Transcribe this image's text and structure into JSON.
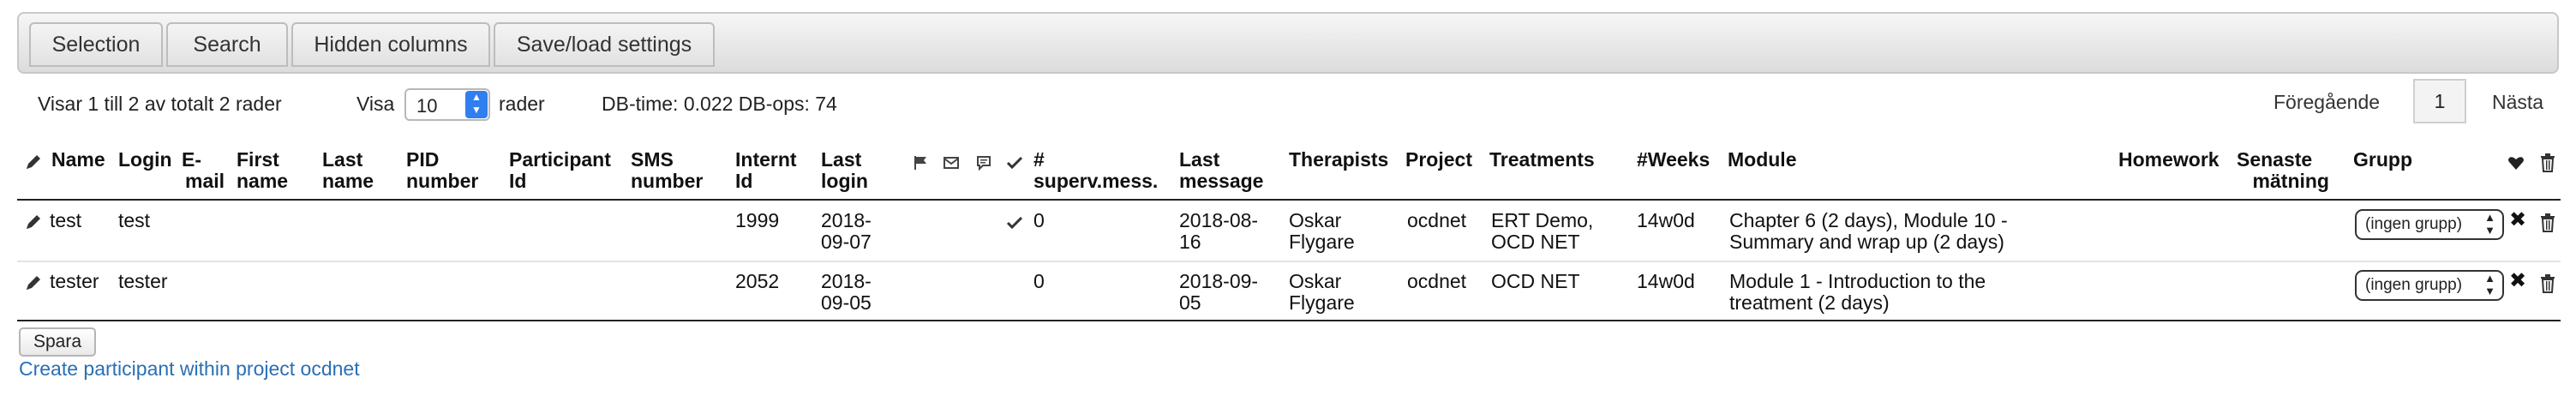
{
  "tabs": [
    {
      "label": "Selection"
    },
    {
      "label": "Search"
    },
    {
      "label": "Hidden columns"
    },
    {
      "label": "Save/load settings"
    }
  ],
  "info": {
    "showing": "Visar 1 till 2 av totalt 2 rader",
    "visa_label": "Visa",
    "visa_value": "10",
    "rader_label": "rader",
    "db_stats": "DB-time: 0.022 DB-ops: 74"
  },
  "pager": {
    "prev": "Föregående",
    "page": "1",
    "next": "Nästa"
  },
  "headers": {
    "name": "Name",
    "login": "Login",
    "email": [
      "E-",
      "mail"
    ],
    "first_name": [
      "First",
      "name"
    ],
    "last_name": [
      "Last",
      "name"
    ],
    "pid": [
      "PID",
      "number"
    ],
    "participant_id": [
      "Participant",
      "Id"
    ],
    "sms": [
      "SMS",
      "number"
    ],
    "intern_id": [
      "Internt",
      "Id"
    ],
    "last_login": [
      "Last",
      "login"
    ],
    "superv": [
      "#",
      "superv.mess."
    ],
    "last_message": [
      "Last",
      "message"
    ],
    "therapists": "Therapists",
    "project": "Project",
    "treatments": "Treatments",
    "weeks": "#Weeks",
    "module": "Module",
    "homework": "Homework",
    "senaste": [
      "Senaste",
      "mätning"
    ],
    "grupp": "Grupp"
  },
  "rows": [
    {
      "name": "test",
      "login": "test",
      "intern_id": "1999",
      "last_login": [
        "2018-",
        "09-07"
      ],
      "checked": true,
      "superv": "0",
      "last_message": [
        "2018-08-",
        "16"
      ],
      "therapists": [
        "Oskar",
        "Flygare"
      ],
      "project": "ocdnet",
      "treatments": [
        "ERT Demo,",
        "OCD NET"
      ],
      "weeks": "14w0d",
      "module": [
        "Chapter 6 (2 days), Module 10 -",
        "Summary and wrap up (2 days)"
      ],
      "grupp": "(ingen grupp)"
    },
    {
      "name": "tester",
      "login": "tester",
      "intern_id": "2052",
      "last_login": [
        "2018-",
        "09-05"
      ],
      "checked": false,
      "superv": "0",
      "last_message": [
        "2018-09-",
        "05"
      ],
      "therapists": [
        "Oskar",
        "Flygare"
      ],
      "project": "ocdnet",
      "treatments": [
        "OCD NET",
        ""
      ],
      "weeks": "14w0d",
      "module": [
        "Module 1 - Introduction to the",
        "treatment (2 days)"
      ],
      "grupp": "(ingen grupp)"
    }
  ],
  "footer": {
    "save": "Spara",
    "create_link": "Create participant within project ocdnet"
  }
}
